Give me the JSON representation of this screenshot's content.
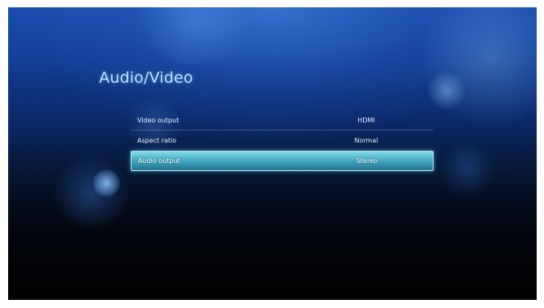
{
  "page": {
    "title": "Audio/Video"
  },
  "settings": [
    {
      "label": "Video output",
      "value": "HDMI",
      "selected": false
    },
    {
      "label": "Aspect ratio",
      "value": "Normal",
      "selected": false
    },
    {
      "label": "Audio output",
      "value": "Stereo",
      "selected": true
    }
  ],
  "colors": {
    "background_top": "#1a4fb0",
    "background_bottom": "#000000",
    "title": "#bfe4ff",
    "selection_highlight": "#5ab8d0"
  }
}
